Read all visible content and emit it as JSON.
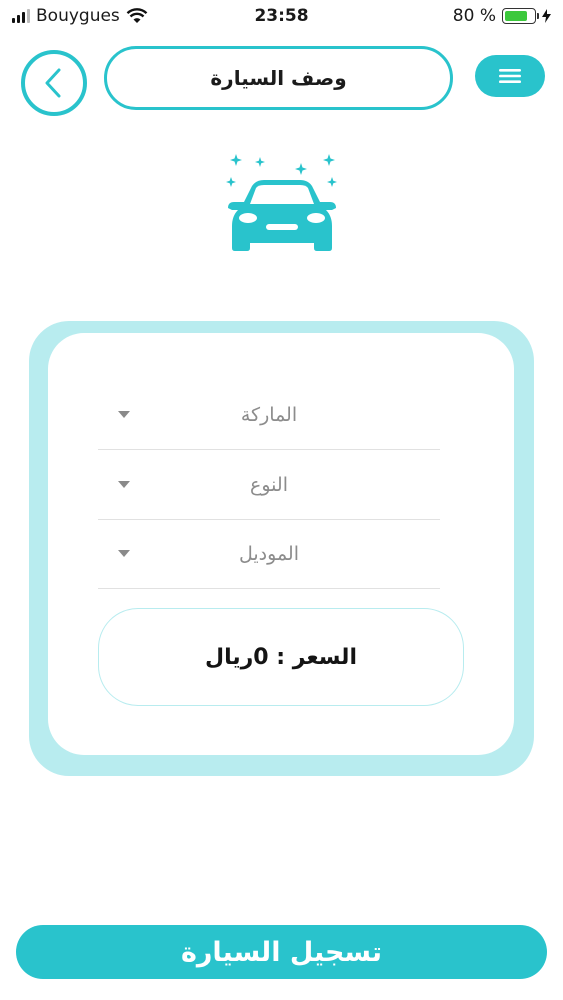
{
  "status_bar": {
    "carrier": "Bouygues",
    "time": "23:58",
    "battery_percent": "80 %",
    "battery_level": 0.8
  },
  "header": {
    "title": "وصف السيارة",
    "back_icon": "chevron-left-icon",
    "menu_icon": "hamburger-menu-icon"
  },
  "hero_icon": "car-wash-sparkle-icon",
  "form": {
    "fields": [
      {
        "label": "الماركة"
      },
      {
        "label": "النوع"
      },
      {
        "label": "الموديل"
      }
    ],
    "price_text": "السعر : 0ريال"
  },
  "submit_label": "تسجيل السيارة",
  "colors": {
    "accent": "#29c3cc",
    "card_border": "#b8ecef"
  }
}
